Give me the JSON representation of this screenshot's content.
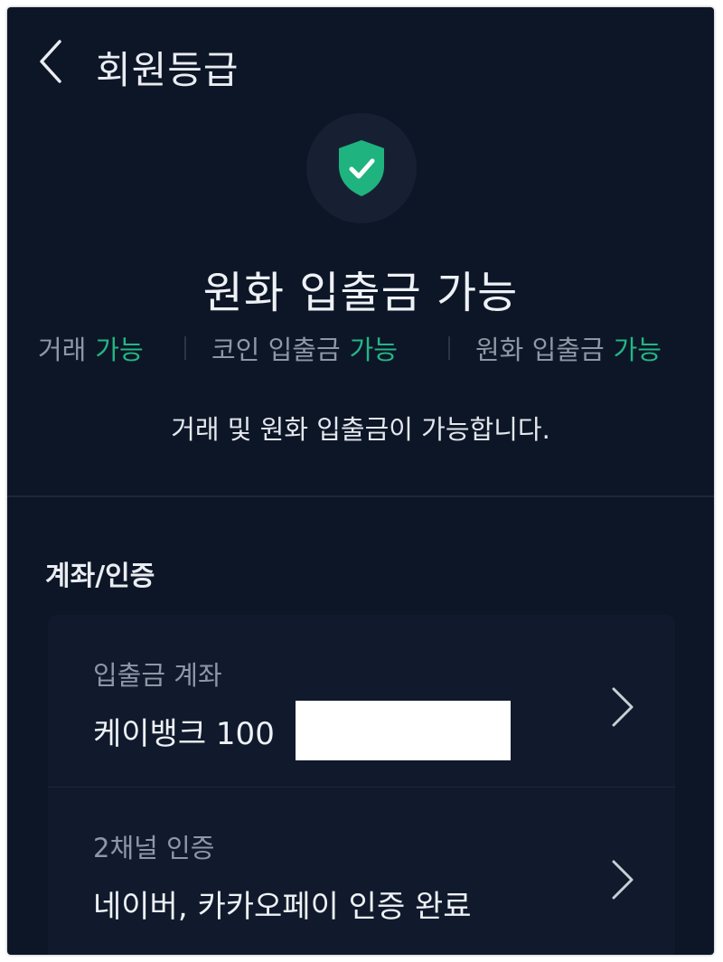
{
  "header": {
    "title": "회원등급",
    "back_icon": "chevron-left-icon"
  },
  "status": {
    "icon": "shield-check-icon",
    "icon_color": "#1fb37f",
    "title": "원화 입출금 가능",
    "permissions": [
      {
        "label": "거래",
        "value": "가능"
      },
      {
        "label": "코인 입출금",
        "value": "가능"
      },
      {
        "label": "원화 입출금",
        "value": "가능"
      }
    ],
    "description": "거래 및 원화 입출금이 가능합니다."
  },
  "section": {
    "title": "계좌/인증"
  },
  "rows": [
    {
      "label": "입출금 계좌",
      "value": "케이뱅크 100"
    },
    {
      "label": "2채널 인증",
      "value": "네이버, 카카오페이 인증 완료"
    }
  ],
  "colors": {
    "background": "#0d1627",
    "accent": "#23b785",
    "text_primary": "#eef1f5",
    "text_secondary": "#8e97a6"
  }
}
